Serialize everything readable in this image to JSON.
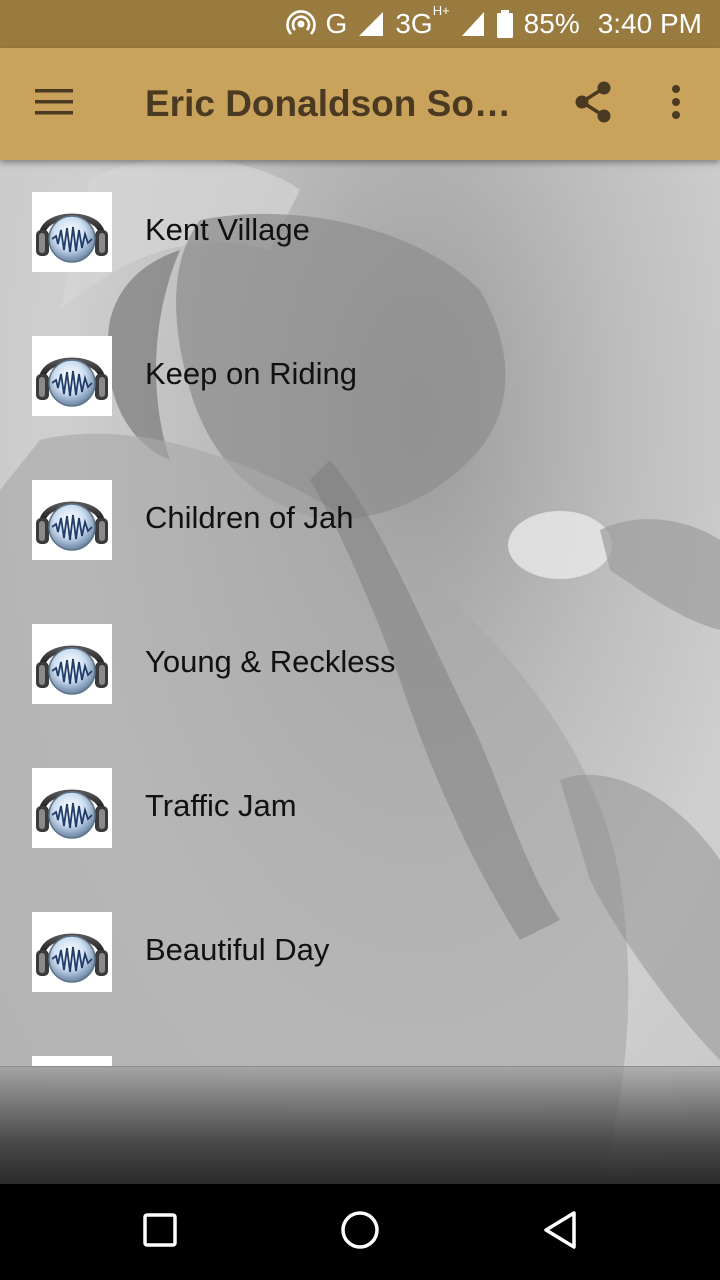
{
  "status_bar": {
    "network_g": "G",
    "network_3g": "3G",
    "network_3g_sup": "H+",
    "battery": "85%",
    "time": "3:40 PM"
  },
  "app_bar": {
    "title": "Eric Donaldson Songs",
    "icons": [
      "menu-icon",
      "share-icon",
      "more-vert-icon"
    ]
  },
  "songs": [
    {
      "title": "Kent Village"
    },
    {
      "title": "Keep on Riding"
    },
    {
      "title": "Children of Jah"
    },
    {
      "title": "Young & Reckless"
    },
    {
      "title": "Traffic Jam"
    },
    {
      "title": "Beautiful Day"
    }
  ],
  "nav_bar": {
    "icons": [
      "recents-icon",
      "home-icon",
      "back-icon"
    ]
  },
  "colors": {
    "status_bar": "#9a7b3f",
    "app_bar": "#c9a25c",
    "title_text": "#4a3a22"
  }
}
